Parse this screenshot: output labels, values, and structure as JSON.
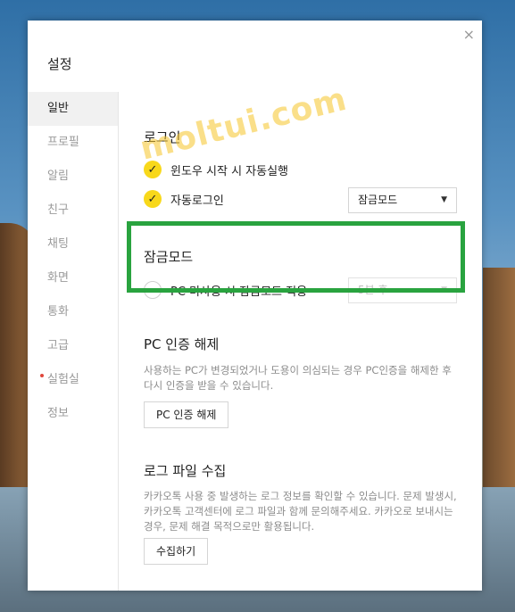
{
  "window": {
    "title": "설정",
    "close_glyph": "×"
  },
  "sidebar": {
    "items": [
      {
        "label": "일반",
        "active": true
      },
      {
        "label": "프로필"
      },
      {
        "label": "알림"
      },
      {
        "label": "친구"
      },
      {
        "label": "채팅"
      },
      {
        "label": "화면"
      },
      {
        "label": "통화"
      },
      {
        "label": "고급"
      },
      {
        "label": "실험실",
        "badge_dot": true
      },
      {
        "label": "정보"
      }
    ]
  },
  "login": {
    "heading": "로그인",
    "auto_start": {
      "label": "윈도우 시작 시 자동실행",
      "checked": true
    },
    "auto_login": {
      "label": "자동로그인",
      "checked": true
    },
    "mode_select": {
      "value": "잠금모드",
      "arrow": "▼"
    }
  },
  "lock": {
    "heading": "잠금모드",
    "apply": {
      "label": "PC 미사용 시 잠금모드 적용",
      "checked": false
    },
    "delay_select": {
      "value": "5분 후",
      "arrow": "▼",
      "disabled": true
    }
  },
  "pc_auth": {
    "heading": "PC 인증 해제",
    "desc": "사용하는 PC가 변경되었거나 도용이 의심되는 경우 PC인증을 해제한 후 다시 인증을 받을 수 있습니다.",
    "button": "PC 인증 해제"
  },
  "log": {
    "heading": "로그 파일 수집",
    "desc": "카카오톡 사용 중 발생하는 로그 정보를 확인할 수 있습니다. 문제 발생시, 카카오톡 고객센터에 로그 파일과 함께 문의해주세요. 카카오로 보내시는 경우, 문제 해결 목적으로만 활용됩니다.",
    "button": "수집하기"
  },
  "watermark": "moltui.com",
  "colors": {
    "accent_yellow": "#f8d81b",
    "highlight_green": "#29a33f"
  }
}
